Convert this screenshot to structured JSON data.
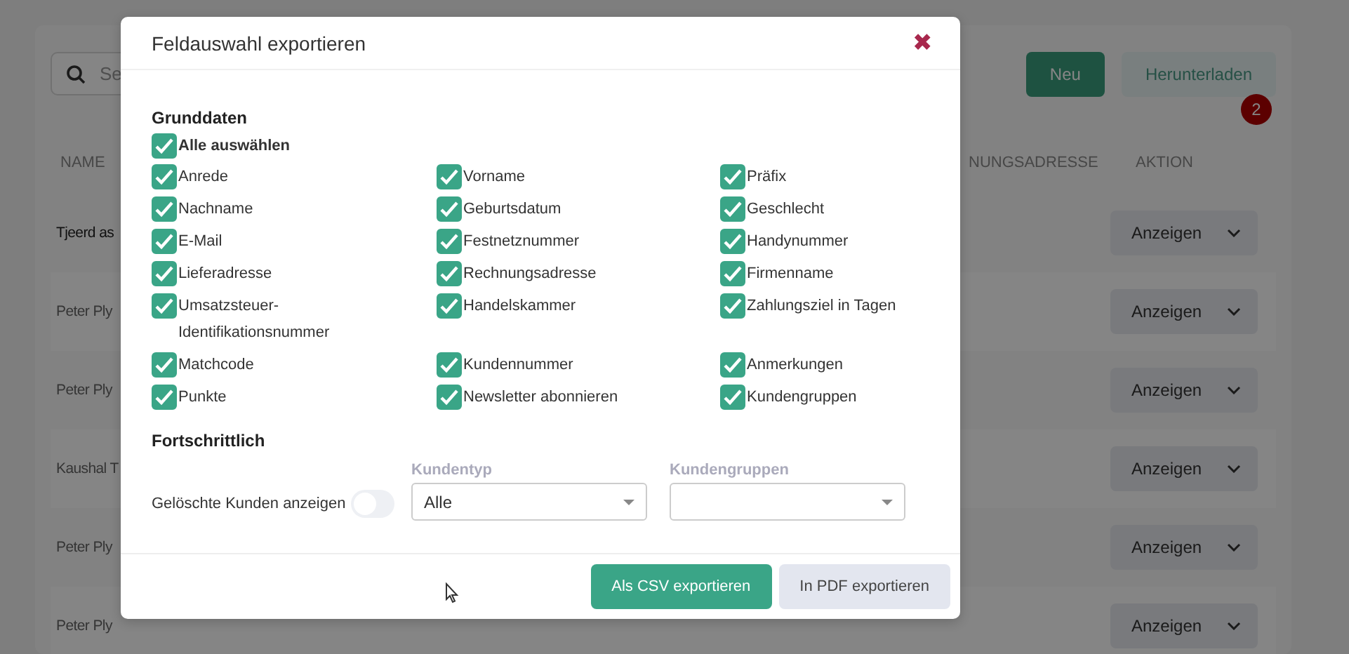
{
  "background": {
    "search": {
      "placeholder": "Se"
    },
    "buttons": [
      {
        "label": "Neu",
        "kind": "primary"
      },
      {
        "label": "Herunterladen",
        "kind": "secondary"
      }
    ],
    "badge": "2",
    "table": {
      "columns": [
        "NAME",
        "NUNGSADRESSE",
        "AKTION"
      ],
      "rows": [
        {
          "name": "Tjeerd as",
          "action": "Anzeigen"
        },
        {
          "name": "Peter Ply",
          "action": "Anzeigen"
        },
        {
          "name": "Peter Ply",
          "action": "Anzeigen"
        },
        {
          "name": "Kaushal T",
          "action": "Anzeigen"
        },
        {
          "name": "Peter Ply",
          "action": "Anzeigen"
        },
        {
          "name": "Peter Ply",
          "action": "Anzeigen"
        }
      ]
    }
  },
  "dialog": {
    "title": "Feldauswahl exportieren",
    "close": "✖",
    "basic": {
      "heading": "Grunddaten",
      "select_all": {
        "label": "Alle auswählen",
        "checked": true
      },
      "fields": [
        {
          "label": "Anrede",
          "checked": true
        },
        {
          "label": "Vorname",
          "checked": true
        },
        {
          "label": "Präfix",
          "checked": true
        },
        {
          "label": "Nachname",
          "checked": true
        },
        {
          "label": "Geburtsdatum",
          "checked": true
        },
        {
          "label": "Geschlecht",
          "checked": true
        },
        {
          "label": "E-Mail",
          "checked": true
        },
        {
          "label": "Festnetznummer",
          "checked": true
        },
        {
          "label": "Handynummer",
          "checked": true
        },
        {
          "label": "Lieferadresse",
          "checked": true
        },
        {
          "label": "Rechnungsadresse",
          "checked": true
        },
        {
          "label": "Firmenname",
          "checked": true
        },
        {
          "label": "Umsatzsteuer-Identifikationsnummer",
          "checked": true
        },
        {
          "label": "Handelskammer",
          "checked": true
        },
        {
          "label": "Zahlungsziel in Tagen",
          "checked": true
        },
        {
          "label": "Matchcode",
          "checked": true
        },
        {
          "label": "Kundennummer",
          "checked": true
        },
        {
          "label": "Anmerkungen",
          "checked": true
        },
        {
          "label": "Punkte",
          "checked": true
        },
        {
          "label": "Newsletter abonnieren",
          "checked": true
        },
        {
          "label": "Kundengruppen",
          "checked": true
        }
      ]
    },
    "advanced": {
      "heading": "Fortschrittlich",
      "toggle": {
        "label": "Gelöschte Kunden anzeigen",
        "on": false
      },
      "selects": [
        {
          "label": "Kundentyp",
          "value": "Alle"
        },
        {
          "label": "Kundengruppen"
        }
      ]
    },
    "buttons": [
      {
        "label": "Als CSV exportieren",
        "kind": "primary"
      },
      {
        "label": "In PDF exportieren",
        "kind": "secondary"
      }
    ]
  }
}
